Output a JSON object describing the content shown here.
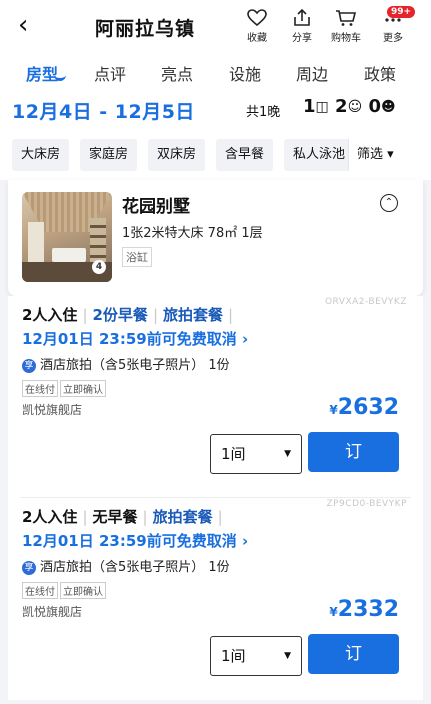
{
  "header": {
    "title": "阿丽拉乌镇",
    "actions": [
      {
        "label": "收藏",
        "icon": "heart-icon"
      },
      {
        "label": "分享",
        "icon": "share-icon"
      },
      {
        "label": "购物车",
        "icon": "cart-icon"
      },
      {
        "label": "更多",
        "icon": "more-icon"
      }
    ],
    "badge": "99+"
  },
  "tabs": [
    "房型",
    "点评",
    "亮点",
    "设施",
    "周边",
    "政策"
  ],
  "active_tab": "房型",
  "dates": {
    "range": "12月4日 - 12月5日",
    "nights": "共1晚",
    "rooms": "1",
    "adults": "2",
    "children": "0"
  },
  "filters": [
    "大床房",
    "家庭房",
    "双床房",
    "含早餐",
    "私人泳池"
  ],
  "filter_button": "筛选 ▾",
  "room": {
    "name": "花园别墅",
    "spec": "1张2米特大床  78㎡  1层",
    "amenity": "浴缸",
    "photo_count": "4"
  },
  "plans": [
    {
      "code": "ORVXA2-BEVYKZ",
      "guests": "2人入住",
      "breakfast": "2份早餐",
      "package": "旅拍套餐",
      "cancel": "12月01日 23:59前可免费取消 ›",
      "pkg_icon": "享",
      "pkg_desc": "酒店旅拍（含5张电子照片）  1份",
      "tags": [
        "在线付",
        "立即确认"
      ],
      "store": "凯悦旗舰店",
      "currency": "¥",
      "price": "2632",
      "qty": "1间",
      "book": "订",
      "breakfast_highlight": true
    },
    {
      "code": "ZP9CD0-BEVYKP",
      "guests": "2人入住",
      "breakfast": "无早餐",
      "package": "旅拍套餐",
      "cancel": "12月01日 23:59前可免费取消 ›",
      "pkg_icon": "享",
      "pkg_desc": "酒店旅拍（含5张电子照片）  1份",
      "tags": [
        "在线付",
        "立即确认"
      ],
      "store": "凯悦旗舰店",
      "currency": "¥",
      "price": "2332",
      "qty": "1间",
      "book": "订",
      "breakfast_highlight": false
    }
  ],
  "colors": {
    "accent": "#1a6fe0",
    "badge": "#e5242b"
  }
}
